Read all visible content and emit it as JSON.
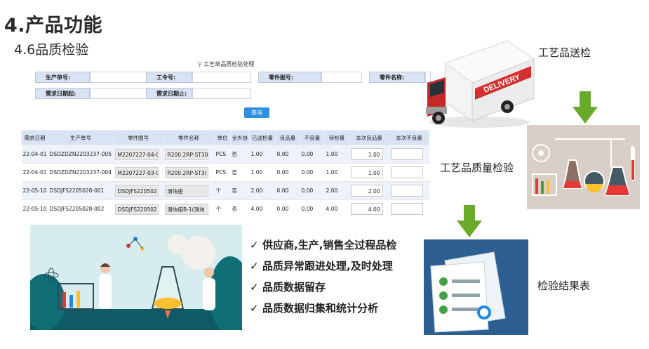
{
  "heading": {
    "title": "4.产品功能",
    "subtitle": "4.6品质检验"
  },
  "form": {
    "title": "工艺单品质检验处理",
    "labels": {
      "order_no": "生产单号:",
      "work_order": "工令号:",
      "part_drawing": "零件图号:",
      "part_name": "零件名称:",
      "date_from": "需求日期起:",
      "date_to": "需求日期止:"
    },
    "query_button": "查询",
    "columns": [
      "需求日期",
      "生产单号",
      "零件图号",
      "零件名称",
      "单位",
      "全外协",
      "已送检量",
      "良品量",
      "不良量",
      "待检量",
      "本次良品量",
      "本次不良量"
    ],
    "rows": [
      [
        "22-04-01",
        "DSDZDZN2203237-005",
        "M2207227-04-0",
        "R200.2RP-ST30",
        "PCS",
        "否",
        "1.00",
        "0.00",
        "0.00",
        "1.00",
        "1.00",
        ""
      ],
      [
        "22-04-01",
        "DSDZDZN2203237-004",
        "M2207227-03-0",
        "R200.2RP-ST3(",
        "PCS",
        "否",
        "1.00",
        "0.00",
        "0.00",
        "1.00",
        "1.00",
        ""
      ],
      [
        "22-05-10",
        "DSDJFS2205028-001",
        "DSDJFS220502",
        "滑块座",
        "个",
        "否",
        "2.00",
        "0.00",
        "0.00",
        "2.00",
        "2.00",
        ""
      ],
      [
        "22-05-10",
        "DSDJFS2205028-002",
        "DSDJFS220502",
        "滑块座B-1(滑块",
        "个",
        "否",
        "4.00",
        "0.00",
        "0.00",
        "4.00",
        "4.00",
        ""
      ]
    ]
  },
  "flow": {
    "step1": "工艺品送检",
    "step2": "工艺品质量检验",
    "step3": "检验结果表",
    "truck_text": "DELIVERY",
    "arrow_color": "#6aaa2a"
  },
  "features": [
    "供应商,生产,销售全过程品检",
    "品质异常跟进处理,及时处理",
    "品质数据留存",
    "品质数据归集和统计分析"
  ],
  "check_glyph": "✓"
}
